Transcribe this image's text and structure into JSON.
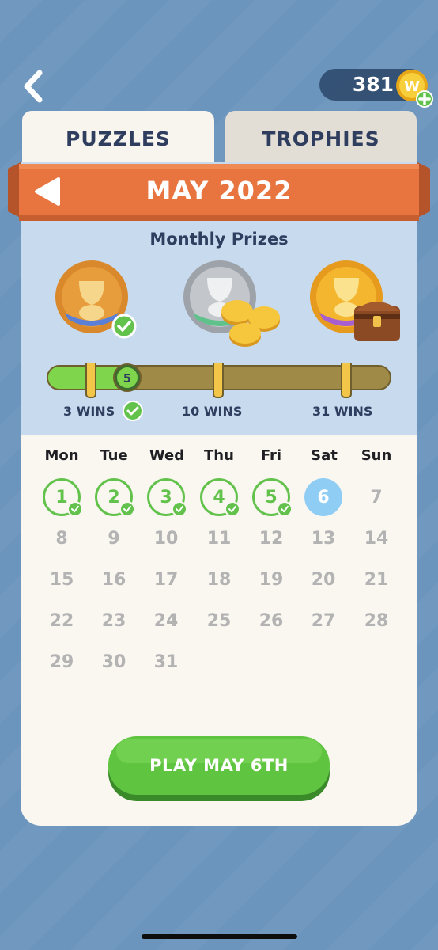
{
  "header": {
    "coins": "381",
    "coin_symbol": "W"
  },
  "tabs": [
    {
      "label": "PUZZLES",
      "active": true
    },
    {
      "label": "TROPHIES",
      "active": false
    }
  ],
  "month": {
    "title": "MAY 2022"
  },
  "prizes": {
    "heading": "Monthly Prizes",
    "tiers": [
      {
        "label": "3 WINS",
        "achieved": true
      },
      {
        "label": "10 WINS",
        "achieved": false
      },
      {
        "label": "31 WINS",
        "achieved": false
      }
    ],
    "progress_wins": "5"
  },
  "calendar": {
    "weekdays": [
      "Mon",
      "Tue",
      "Wed",
      "Thu",
      "Fri",
      "Sat",
      "Sun"
    ],
    "weeks": [
      [
        "1",
        "2",
        "3",
        "4",
        "5",
        "6",
        "7"
      ],
      [
        "8",
        "9",
        "10",
        "11",
        "12",
        "13",
        "14"
      ],
      [
        "15",
        "16",
        "17",
        "18",
        "19",
        "20",
        "21"
      ],
      [
        "22",
        "23",
        "24",
        "25",
        "26",
        "27",
        "28"
      ],
      [
        "29",
        "30",
        "31"
      ]
    ],
    "won_days": [
      "1",
      "2",
      "3",
      "4",
      "5"
    ],
    "today": "6"
  },
  "play_button": {
    "label": "PLAY MAY 6TH"
  },
  "colors": {
    "accent_green": "#62c24b",
    "ribbon_orange": "#e8743f",
    "navy": "#2f3d5f",
    "today_blue": "#8fcdf4"
  }
}
